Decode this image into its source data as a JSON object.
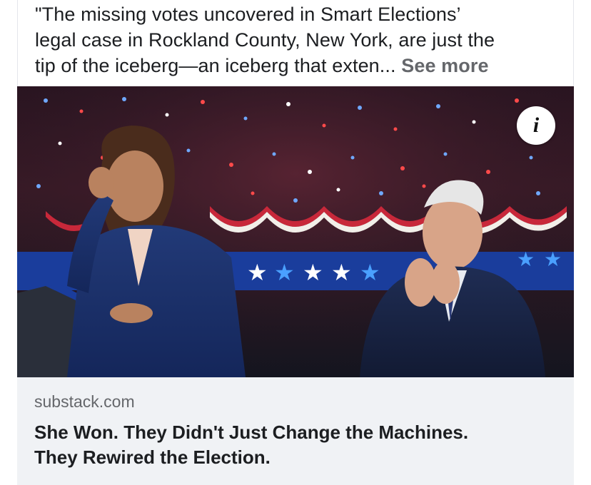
{
  "post": {
    "text_lines": [
      "\"The missing votes uncovered in Smart Elections’",
      "legal case in Rockland County, New York, are just the",
      "tip of the iceberg—an iceberg that exten..."
    ],
    "see_more_label": "See more"
  },
  "image": {
    "info_icon_glyph": "i"
  },
  "link_preview": {
    "domain": "substack.com",
    "headline_lines": [
      "She Won. They Didn't Just Change the Machines.",
      "They Rewired the Election."
    ]
  },
  "colors": {
    "see_more": "#65676b",
    "preview_bg": "#f0f2f5",
    "text": "#1c1e21"
  }
}
